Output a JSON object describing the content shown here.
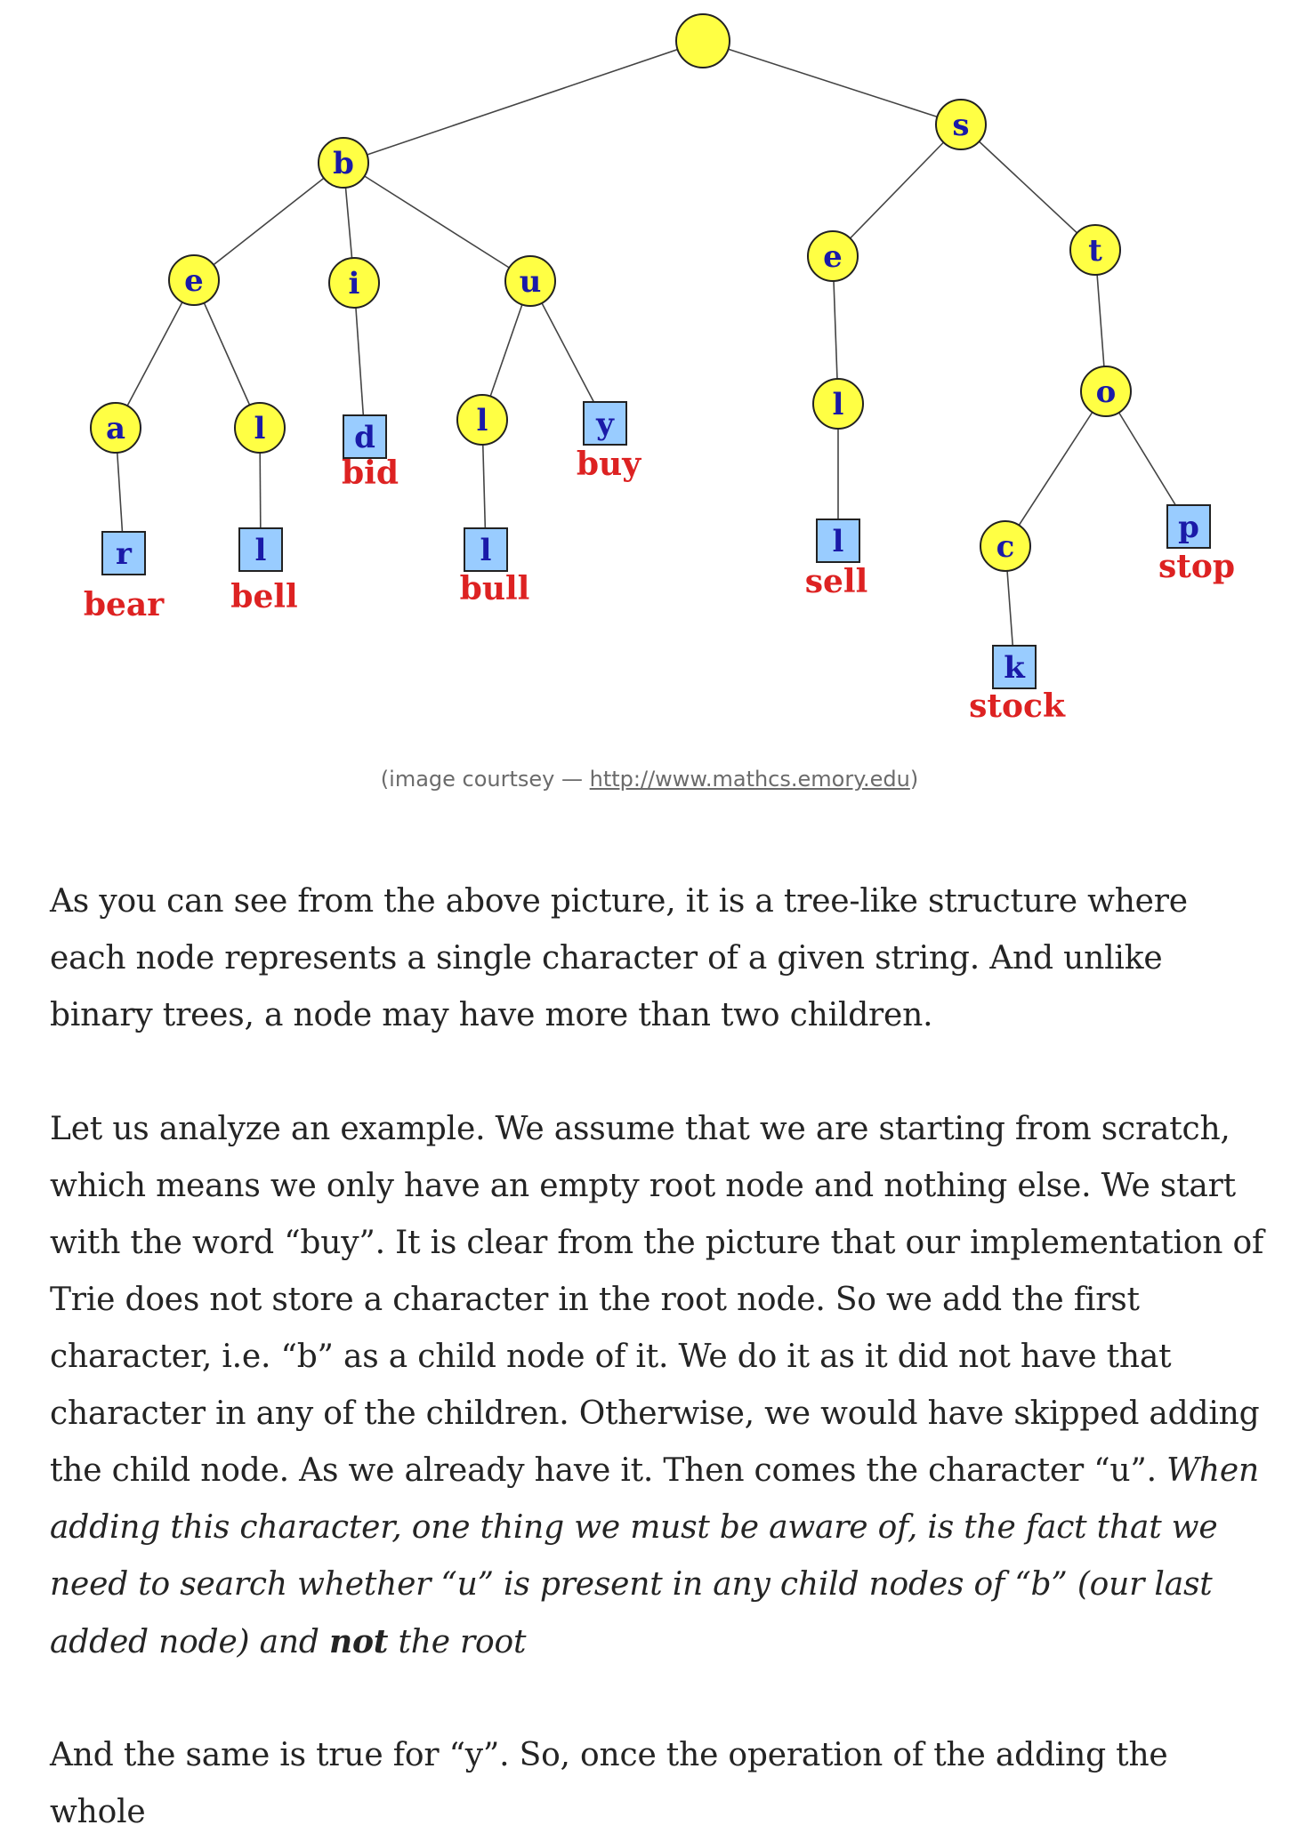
{
  "trie_figure": {
    "root_label": "",
    "nodes": [
      {
        "id": "b",
        "label": "b",
        "shape": "circle"
      },
      {
        "id": "s",
        "label": "s",
        "shape": "circle"
      },
      {
        "id": "e1",
        "label": "e",
        "shape": "circle"
      },
      {
        "id": "i",
        "label": "i",
        "shape": "circle"
      },
      {
        "id": "u",
        "label": "u",
        "shape": "circle"
      },
      {
        "id": "a",
        "label": "a",
        "shape": "circle"
      },
      {
        "id": "l1",
        "label": "l",
        "shape": "circle"
      },
      {
        "id": "d",
        "label": "d",
        "shape": "square"
      },
      {
        "id": "l2",
        "label": "l",
        "shape": "circle"
      },
      {
        "id": "y",
        "label": "y",
        "shape": "square"
      },
      {
        "id": "r",
        "label": "r",
        "shape": "square"
      },
      {
        "id": "l3",
        "label": "l",
        "shape": "square"
      },
      {
        "id": "l4",
        "label": "l",
        "shape": "square"
      },
      {
        "id": "e2",
        "label": "e",
        "shape": "circle"
      },
      {
        "id": "t",
        "label": "t",
        "shape": "circle"
      },
      {
        "id": "l5",
        "label": "l",
        "shape": "circle"
      },
      {
        "id": "o",
        "label": "o",
        "shape": "circle"
      },
      {
        "id": "l6",
        "label": "l",
        "shape": "square"
      },
      {
        "id": "c",
        "label": "c",
        "shape": "circle"
      },
      {
        "id": "p",
        "label": "p",
        "shape": "square"
      },
      {
        "id": "k",
        "label": "k",
        "shape": "square"
      }
    ],
    "edges": [
      [
        "root",
        "b"
      ],
      [
        "root",
        "s"
      ],
      [
        "b",
        "e1"
      ],
      [
        "b",
        "i"
      ],
      [
        "b",
        "u"
      ],
      [
        "e1",
        "a"
      ],
      [
        "e1",
        "l1"
      ],
      [
        "a",
        "r"
      ],
      [
        "l1",
        "l3"
      ],
      [
        "i",
        "d"
      ],
      [
        "u",
        "l2"
      ],
      [
        "u",
        "y"
      ],
      [
        "l2",
        "l4"
      ],
      [
        "s",
        "e2"
      ],
      [
        "s",
        "t"
      ],
      [
        "e2",
        "l5"
      ],
      [
        "l5",
        "l6"
      ],
      [
        "t",
        "o"
      ],
      [
        "o",
        "c"
      ],
      [
        "o",
        "p"
      ],
      [
        "c",
        "k"
      ]
    ],
    "words": [
      {
        "node": "r",
        "text": "bear"
      },
      {
        "node": "l3",
        "text": "bell"
      },
      {
        "node": "d",
        "text": "bid"
      },
      {
        "node": "l4",
        "text": "bull"
      },
      {
        "node": "y",
        "text": "buy"
      },
      {
        "node": "l6",
        "text": "sell"
      },
      {
        "node": "k",
        "text": "stock"
      },
      {
        "node": "p",
        "text": "stop"
      }
    ],
    "colors": {
      "circle_fill": "#ffff44",
      "square_fill": "#99ccff",
      "letter": "#1a1aa8",
      "word": "#dd2222",
      "edge": "#444444"
    }
  },
  "caption": {
    "prefix": "(image courtsey — ",
    "link_text": "http://www.mathcs.emory.edu",
    "suffix": ")"
  },
  "paragraphs": {
    "p1": "As you can see from the above picture, it is a tree-like structure where each node represents a single character of a given string. And unlike binary trees, a node may have more than two children.",
    "p2_plain": "Let us analyze an example. We assume that we are starting from scratch, which means we only have an empty root node and nothing else. We start with the word “buy”. It is clear from the picture that our implementation of Trie does not store a character in the root node. So we add the first character, i.e. “b” as a child node of it. We do it as it did not have that character in any of the children. Otherwise, we would have skipped adding the child node. As we already have it. Then comes the character “u”. ",
    "p2_italic_a": "When adding this character, one thing we must be aware of, is the fact that we need to search whether “u” is present in any child nodes of “b” (our last added node) and ",
    "p2_bold": "not",
    "p2_italic_b": " the root",
    "p3": "And the same is true for “y”. So, once the operation of the adding the whole"
  }
}
